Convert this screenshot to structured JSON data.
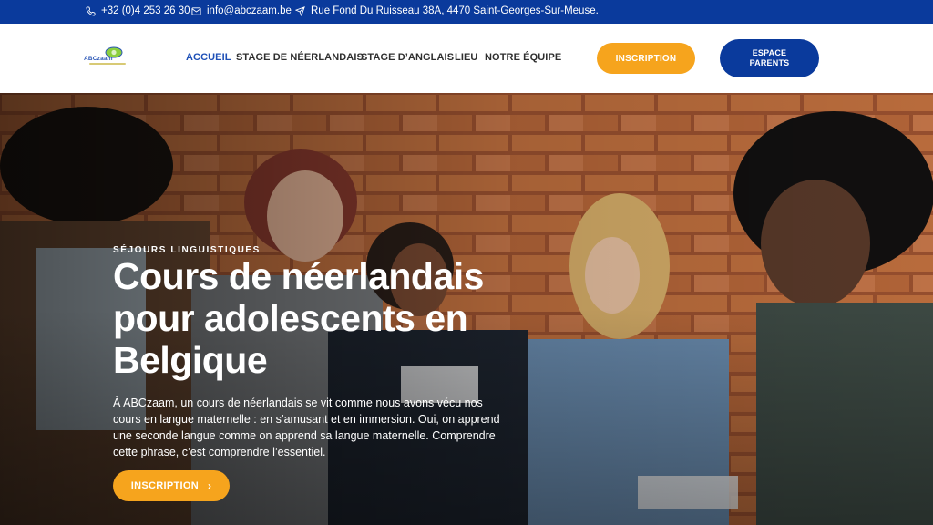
{
  "topbar": {
    "phone": "+32 (0)4 253 26 30",
    "email": "info@abczaam.be",
    "address": "Rue Fond Du Ruisseau 38A, 4470 Saint-Georges-Sur-Meuse."
  },
  "header": {
    "logo_text": "ABCzaam",
    "nav": [
      {
        "label": "ACCUEIL",
        "active": true
      },
      {
        "label": "STAGE DE NÉERLANDAIS",
        "active": false
      },
      {
        "label": "STAGE D’ANGLAIS",
        "active": false
      },
      {
        "label": "LIEU",
        "active": false
      },
      {
        "label": "NOTRE ÉQUIPE",
        "active": false
      }
    ],
    "inscription_label": "INSCRIPTION",
    "espace_line1": "ESPACE",
    "espace_line2": "PARENTS"
  },
  "hero": {
    "eyebrow": "SÉJOURS LINGUISTIQUES",
    "title_lines": [
      "Cours de néerlandais",
      "pour adolescents en",
      "Belgique"
    ],
    "text_lines": [
      "À ABCzaam, un cours de néerlandais se vit comme nous avons vécu nos",
      "cours en langue maternelle : en s’amusant et en immersion. Oui, on apprend",
      "une seconde langue comme on apprend sa langue maternelle. Comprendre",
      "cette phrase, c’est comprendre l’essentiel."
    ],
    "button_label": "INSCRIPTION",
    "button_icon": "chevron-right-icon"
  },
  "colors": {
    "brand_blue": "#0a3a9c",
    "accent_orange": "#f6a41d",
    "nav_active": "#1e50b7"
  },
  "icons": {
    "phone": "phone-icon",
    "email": "mail-icon",
    "address": "send-icon"
  }
}
